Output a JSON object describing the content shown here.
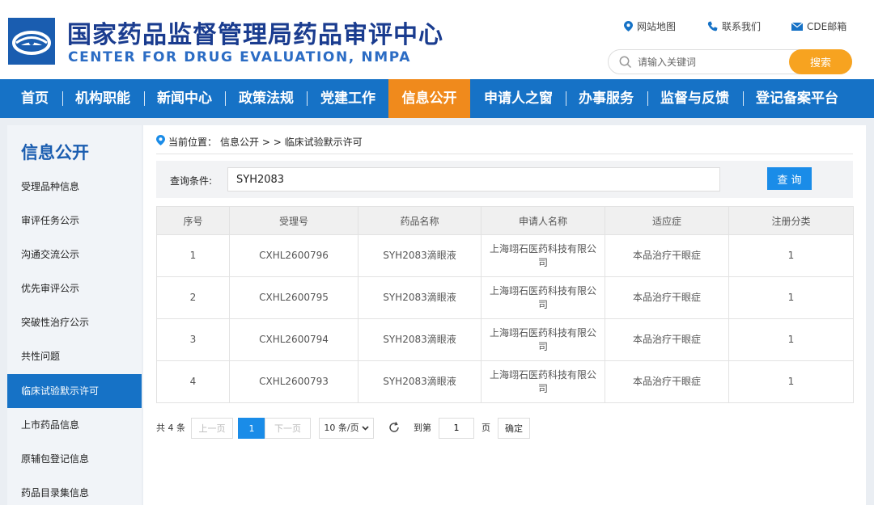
{
  "header": {
    "title_cn": "国家药品监督管理局药品审评中心",
    "title_en": "CENTER FOR DRUG EVALUATION, NMPA",
    "links": [
      {
        "label": "网站地图",
        "icon": "location-pin-icon"
      },
      {
        "label": "联系我们",
        "icon": "phone-icon"
      },
      {
        "label": "CDE邮箱",
        "icon": "mail-icon"
      }
    ],
    "search": {
      "placeholder": "请输入关键词",
      "button": "搜索"
    }
  },
  "nav": {
    "items": [
      "首页",
      "机构职能",
      "新闻中心",
      "政策法规",
      "党建工作",
      "信息公开",
      "申请人之窗",
      "办事服务",
      "监督与反馈",
      "登记备案平台"
    ],
    "active_index": 5
  },
  "sidebar": {
    "title": "信息公开",
    "items": [
      "受理品种信息",
      "审评任务公示",
      "沟通交流公示",
      "优先审评公示",
      "突破性治疗公示",
      "共性问题",
      "临床试验默示许可",
      "上市药品信息",
      "原辅包登记信息",
      "药品目录集信息"
    ],
    "active_index": 6
  },
  "breadcrumb": {
    "prefix": "当前位置：",
    "path": "信息公开 >  > 临床试验默示许可"
  },
  "query": {
    "label": "查询条件:",
    "value": "SYH2083",
    "button": "查 询"
  },
  "table": {
    "headers": [
      "序号",
      "受理号",
      "药品名称",
      "申请人名称",
      "适应症",
      "注册分类"
    ],
    "rows": [
      [
        "1",
        "CXHL2600796",
        "SYH2083滴眼液",
        "上海翊石医药科技有限公司",
        "本品治疗干眼症",
        "1"
      ],
      [
        "2",
        "CXHL2600795",
        "SYH2083滴眼液",
        "上海翊石医药科技有限公司",
        "本品治疗干眼症",
        "1"
      ],
      [
        "3",
        "CXHL2600794",
        "SYH2083滴眼液",
        "上海翊石医药科技有限公司",
        "本品治疗干眼症",
        "1"
      ],
      [
        "4",
        "CXHL2600793",
        "SYH2083滴眼液",
        "上海翊石医药科技有限公司",
        "本品治疗干眼症",
        "1"
      ]
    ]
  },
  "pager": {
    "total": "共 4 条",
    "prev": "上一页",
    "current": "1",
    "next": "下一页",
    "page_size": "10 条/页",
    "goto_label": "到第",
    "goto_value": "1",
    "page_unit": "页",
    "confirm": "确定"
  },
  "colors": {
    "brand_blue": "#1672c6",
    "accent_orange": "#f08a1c",
    "search_orange": "#f7a320",
    "button_blue": "#1a8ce8"
  }
}
